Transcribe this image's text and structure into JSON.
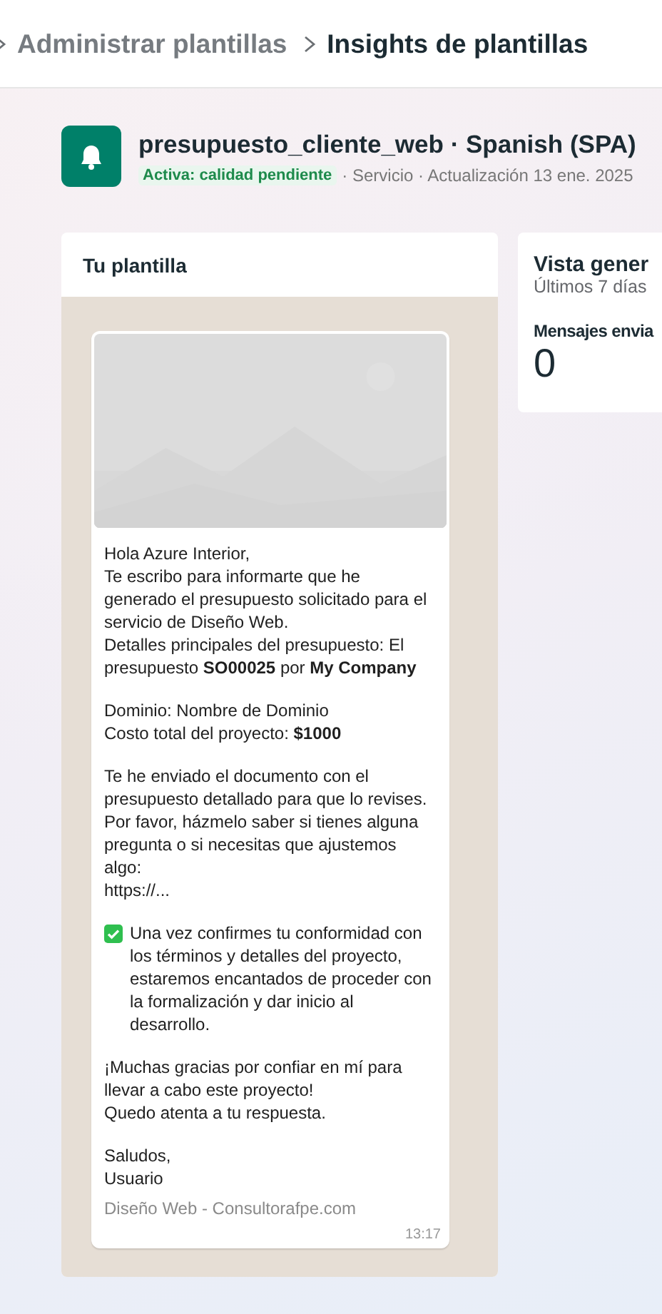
{
  "breadcrumb": [
    {
      "label": "Administrar plantillas",
      "selected": false
    },
    {
      "label": "Insights de plantillas",
      "selected": true
    }
  ],
  "template": {
    "name": "presupuesto_cliente_web · Spanish (SPA)",
    "status": "Activa: calidad pendiente",
    "meta": "· Servicio · Actualización 13 ene. 2025"
  },
  "preview": {
    "title": "Tu plantilla",
    "body": [
      {
        "kind": "text",
        "text": "Hola Azure Interior,\nTe escribo para informarte que he generado el presupuesto solicitado para el servicio de Diseño Web.\nDetalles principales del presupuesto: El presupuesto **SO00025** por **My Company**"
      },
      {
        "kind": "text",
        "text": "Dominio: Nombre de Dominio\nCosto total del proyecto: **$1000**"
      },
      {
        "kind": "text",
        "text": "Te he enviado el documento con el presupuesto detallado para que lo revises. Por favor, házmelo saber si tienes alguna pregunta o si necesitas que ajustemos algo:\nhttps://..."
      },
      {
        "kind": "checked",
        "text": "Una vez confirmes tu conformidad con los términos y detalles del proyecto, estaremos encantados de proceder con la formalización y dar inicio al desarrollo."
      },
      {
        "kind": "text",
        "text": "¡Muchas gracias por confiar en mí para llevar a cabo este proyecto!\nQuedo atenta a tu respuesta."
      },
      {
        "kind": "text",
        "text": "Saludos,\nUsuario"
      }
    ],
    "footer": "Diseño Web - Consultorafpe.com",
    "time": "13:17"
  },
  "overview": {
    "title": "Vista gener",
    "period": "Últimos 7 días",
    "metric_label": "Mensajes envia",
    "metric_value": "0"
  }
}
